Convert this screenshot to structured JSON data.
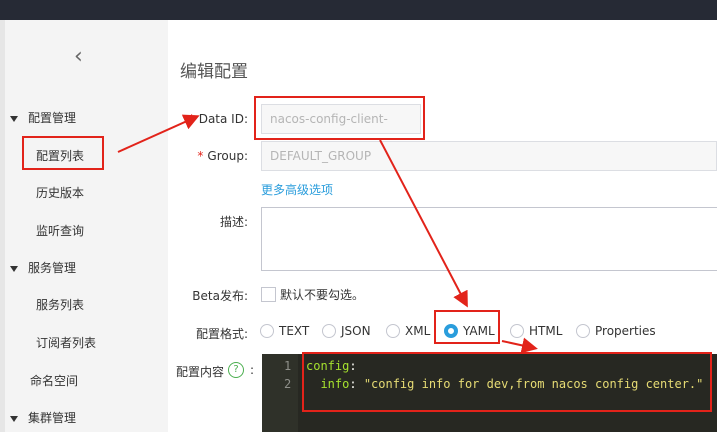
{
  "sidebar": {
    "back_icon": "chevron-left-icon",
    "groups": [
      {
        "label": "配置管理",
        "items": [
          "配置列表",
          "历史版本",
          "监听查询"
        ]
      },
      {
        "label": "服务管理",
        "items": [
          "服务列表",
          "订阅者列表"
        ]
      }
    ],
    "namespace": "命名空间",
    "cluster": "集群管理"
  },
  "page": {
    "title": "编辑配置"
  },
  "form": {
    "data_id": {
      "label": "Data ID:",
      "required": "*",
      "value": "nacos-config-client-dev.yaml"
    },
    "group": {
      "label": "Group:",
      "required": "*",
      "value": "DEFAULT_GROUP"
    },
    "advanced_link": "更多高级选项",
    "desc": {
      "label": "描述:"
    },
    "beta": {
      "label": "Beta发布:",
      "checkbox_label": "默认不要勾选。"
    },
    "format": {
      "label": "配置格式:",
      "options": [
        "TEXT",
        "JSON",
        "XML",
        "YAML",
        "HTML",
        "Properties"
      ],
      "selected": "YAML"
    },
    "content": {
      "label": "配置内容",
      "help": "?",
      "lines": [
        {
          "num": "1",
          "key": "config",
          "sep": ":"
        },
        {
          "num": "2",
          "indent": "  ",
          "key": "info",
          "sep": ": ",
          "value": "\"config info for dev,from nacos config center.\""
        }
      ]
    }
  },
  "colors": {
    "accent": "#2a9ddc",
    "annotation": "#e2231a",
    "topbar": "#262a35"
  }
}
